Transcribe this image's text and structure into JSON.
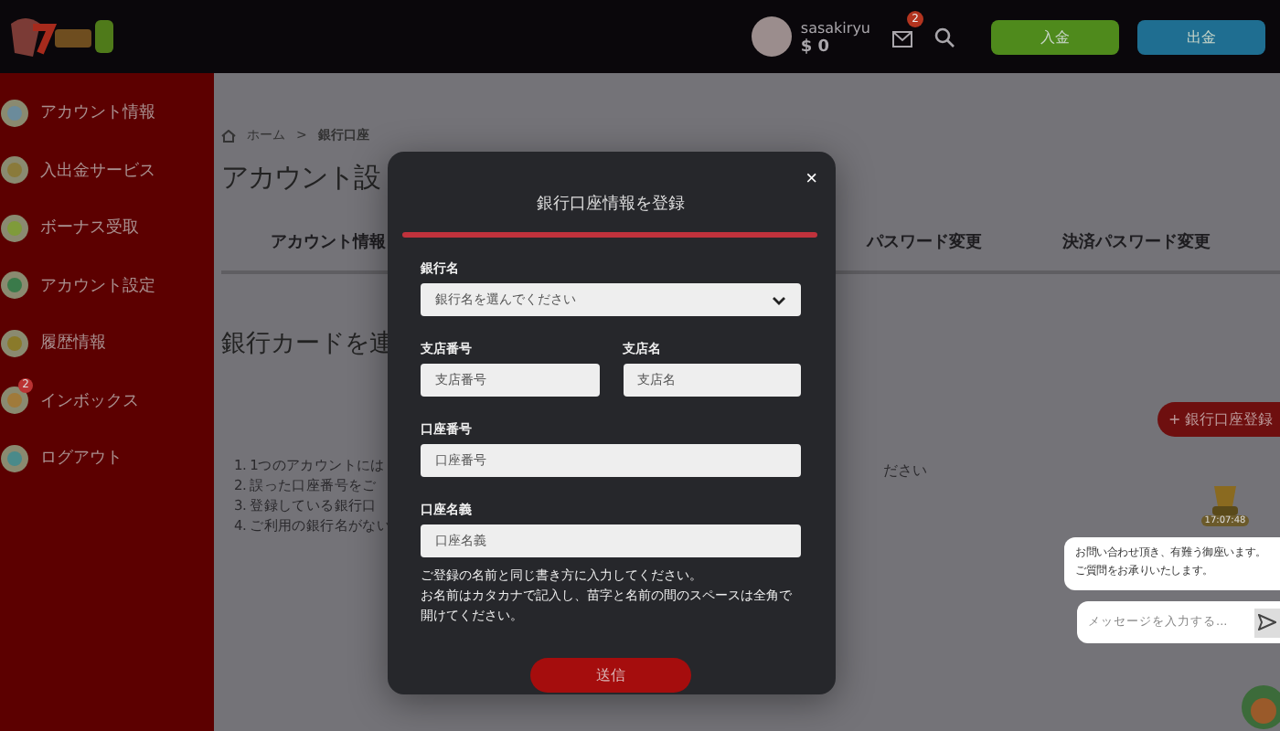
{
  "header": {
    "username": "sasakiryu",
    "balance": "$ 0",
    "mail_badge": "2",
    "buttons": [
      {
        "kind": "deposit",
        "label": "入金"
      },
      {
        "kind": "withdraw",
        "label": "出金"
      }
    ]
  },
  "sidebar": {
    "items": [
      {
        "label": "アカウント情報"
      },
      {
        "label": "入出金サービス"
      },
      {
        "label": "ボーナス受取"
      },
      {
        "label": "アカウント設定"
      },
      {
        "label": "履歴情報"
      },
      {
        "label": "インボックス",
        "badge": "2"
      },
      {
        "label": "ログアウト"
      }
    ]
  },
  "breadcrumb": {
    "home": "ホーム",
    "separator": ">",
    "current": "銀行口座"
  },
  "page_title": "アカウント設",
  "tabs": [
    {
      "label": "アカウント情報",
      "selected": false
    },
    {
      "label": "パスワード変更",
      "selected": false
    },
    {
      "label": "決済パスワード変更",
      "selected": false
    }
  ],
  "section_title": "銀行カードを連",
  "add_button": "+ 銀行口座登録",
  "note_tail": "ださい",
  "notes": [
    "1. 1つのアカウントには",
    "2. 誤った口座番号をご",
    "3. 登録している銀行口",
    "4. ご利用の銀行名がない"
  ],
  "modal": {
    "title": "銀行口座情報を登録",
    "close": "×",
    "fields": [
      {
        "kind": "select",
        "label": "銀行名",
        "placeholder": "銀行名を選んでください"
      },
      {
        "kind": "short",
        "label": "支店番号",
        "placeholder": "支店番号"
      },
      {
        "kind": "short",
        "label": "支店名",
        "placeholder": "支店名"
      },
      {
        "kind": "input",
        "label": "口座番号",
        "placeholder": "口座番号"
      },
      {
        "kind": "input",
        "label": "口座名義",
        "placeholder": "口座名義"
      }
    ],
    "help": [
      "ご登録の名前と同じ書き方に入力してください。",
      "お名前はカタカナで記入し、苗字と名前の間のスペースは全角で開けてください。"
    ],
    "submit": "送信"
  },
  "chat": {
    "time": "17:07:48",
    "message": "お問い合わせ頂き、有難う御座います。ご質問をお承りいたします。",
    "placeholder": "メッセージを入力する..."
  }
}
